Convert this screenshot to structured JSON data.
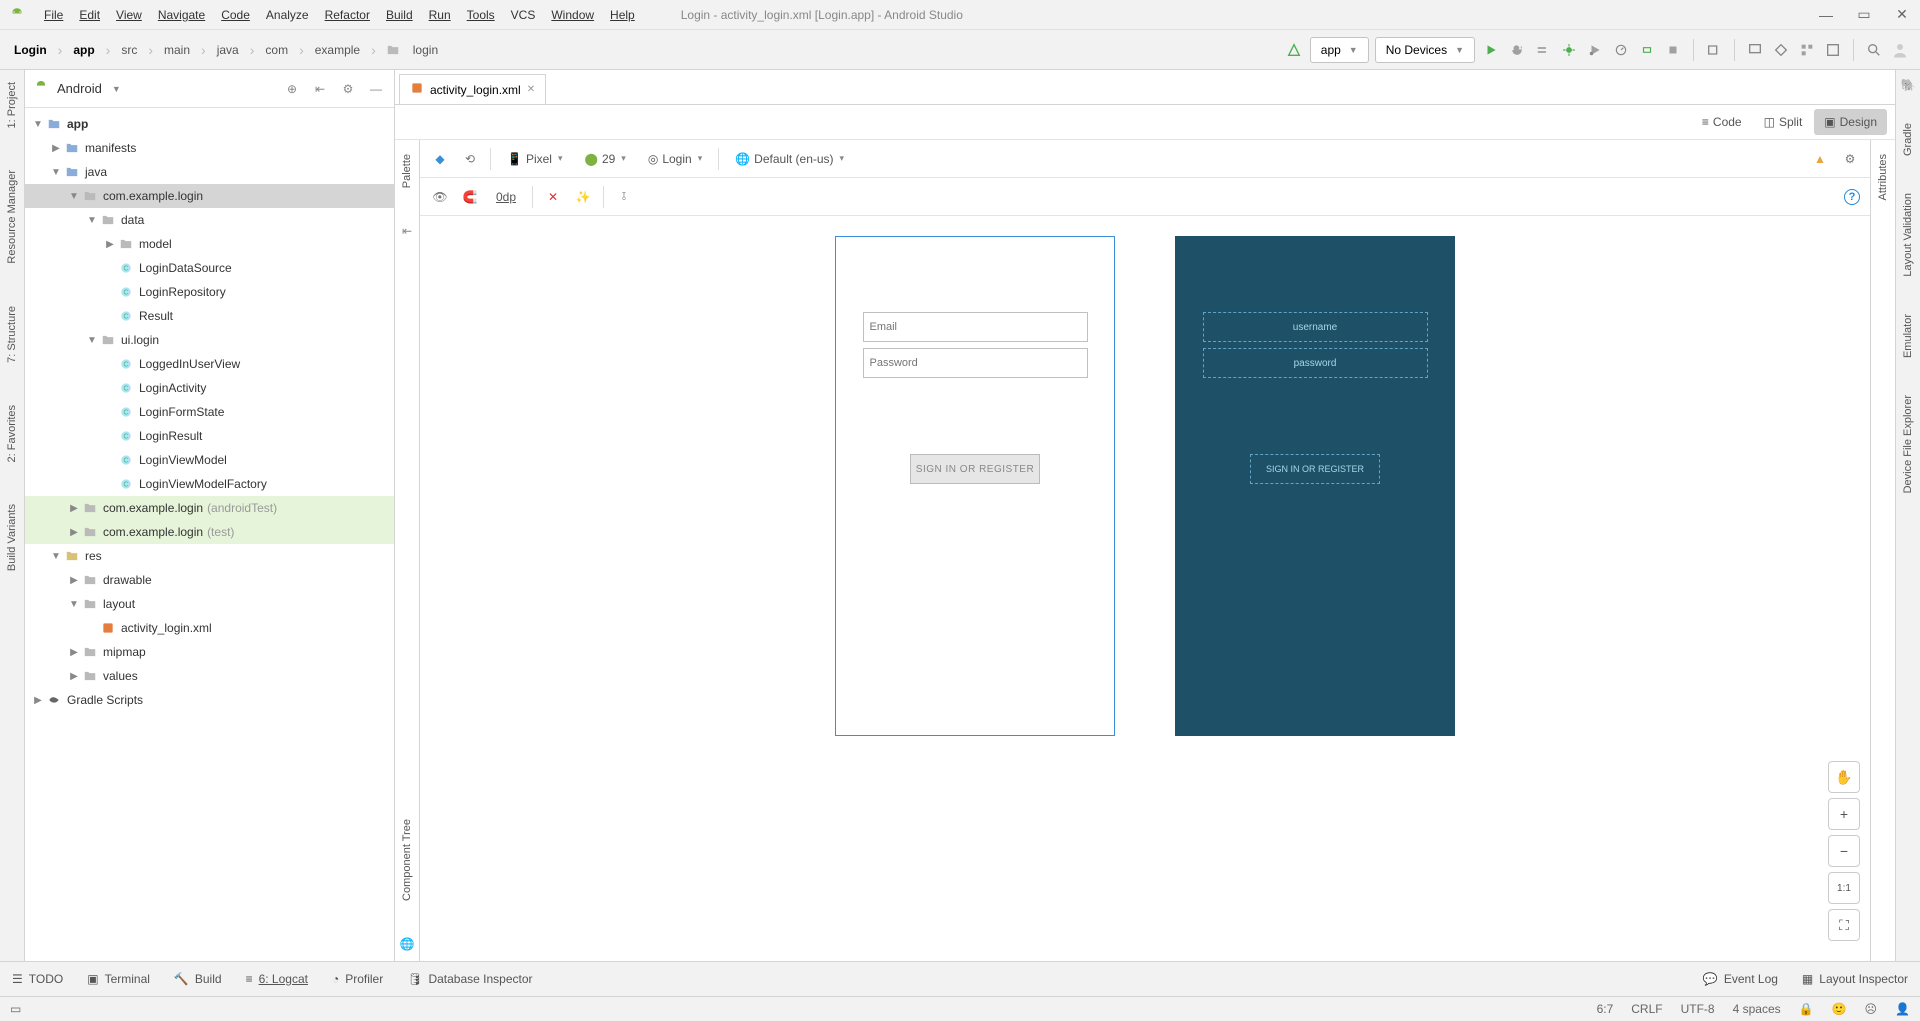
{
  "window_title": "Login - activity_login.xml [Login.app] - Android Studio",
  "menu": [
    "File",
    "Edit",
    "View",
    "Navigate",
    "Code",
    "Analyze",
    "Refactor",
    "Build",
    "Run",
    "Tools",
    "VCS",
    "Window",
    "Help"
  ],
  "breadcrumb": [
    "Login",
    "app",
    "src",
    "main",
    "java",
    "com",
    "example",
    "login"
  ],
  "run_config": "app",
  "device_selector": "No Devices",
  "project_view_label": "Android",
  "tree": {
    "app": "app",
    "manifests": "manifests",
    "java": "java",
    "pkg_main": "com.example.login",
    "data": "data",
    "model": "model",
    "LoginDataSource": "LoginDataSource",
    "LoginRepository": "LoginRepository",
    "Result": "Result",
    "ui_login": "ui.login",
    "LoggedInUserView": "LoggedInUserView",
    "LoginActivity": "LoginActivity",
    "LoginFormState": "LoginFormState",
    "LoginResult": "LoginResult",
    "LoginViewModel": "LoginViewModel",
    "LoginViewModelFactory": "LoginViewModelFactory",
    "pkg_android_test": "com.example.login",
    "pkg_android_test_suffix": "(androidTest)",
    "pkg_test": "com.example.login",
    "pkg_test_suffix": "(test)",
    "res": "res",
    "drawable": "drawable",
    "layout": "layout",
    "activity_login_xml": "activity_login.xml",
    "mipmap": "mipmap",
    "values": "values",
    "gradle_scripts": "Gradle Scripts"
  },
  "tab_file": "activity_login.xml",
  "view_modes": {
    "code": "Code",
    "split": "Split",
    "design": "Design"
  },
  "design_toolbar": {
    "device": "Pixel",
    "api": "29",
    "theme": "Login",
    "locale": "Default (en-us)",
    "margin": "0dp"
  },
  "preview": {
    "email_placeholder": "Email",
    "password_placeholder": "Password",
    "button": "SIGN IN OR REGISTER",
    "bp_username": "username",
    "bp_password": "password",
    "bp_button": "SIGN IN OR REGISTER"
  },
  "left_gutter": [
    "1: Project",
    "Resource Manager",
    "7: Structure",
    "2: Favorites",
    "Build Variants"
  ],
  "right_gutter": [
    "Gradle",
    "Layout Validation",
    "Emulator",
    "Device File Explorer"
  ],
  "inner_left": [
    "Palette",
    "Component Tree"
  ],
  "inner_right": [
    "Attributes"
  ],
  "bottom_tools": {
    "todo": "TODO",
    "terminal": "Terminal",
    "build": "Build",
    "logcat": "6: Logcat",
    "profiler": "Profiler",
    "dbinspector": "Database Inspector",
    "eventlog": "Event Log",
    "layoutinsp": "Layout Inspector"
  },
  "status": {
    "pos": "6:7",
    "line_sep": "CRLF",
    "encoding": "UTF-8",
    "indent": "4 spaces"
  },
  "zoom": {
    "ratio": "1:1"
  }
}
